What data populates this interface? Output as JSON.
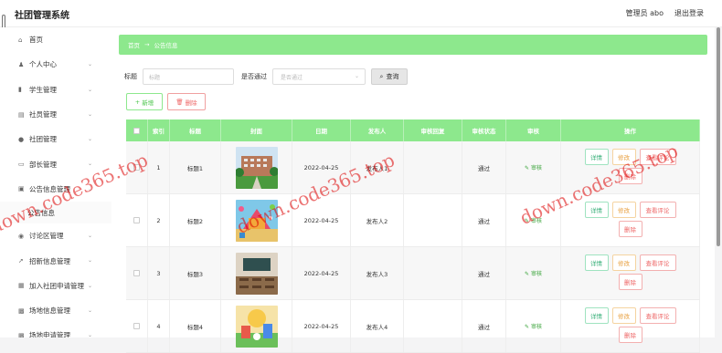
{
  "app": {
    "title": "社团管理系统",
    "admin": "管理员 abo",
    "logout": "退出登录"
  },
  "sidebar": {
    "items": [
      {
        "label": "首页",
        "icon": "home-icon",
        "glyph": "⌂",
        "chevron": false
      },
      {
        "label": "个人中心",
        "icon": "user-icon",
        "glyph": "♟",
        "chevron": true
      },
      {
        "label": "学生管理",
        "icon": "chart-icon",
        "glyph": "▮",
        "chevron": true
      },
      {
        "label": "社员管理",
        "icon": "members-icon",
        "glyph": "▤",
        "chevron": true
      },
      {
        "label": "社团管理",
        "icon": "pin-icon",
        "glyph": "●",
        "chevron": true
      },
      {
        "label": "部长管理",
        "icon": "folder-icon",
        "glyph": "▭",
        "chevron": true
      },
      {
        "label": "公告信息管理",
        "icon": "notice-icon",
        "glyph": "▣",
        "chevron": true
      },
      {
        "label": "公告信息",
        "sub": true
      },
      {
        "label": "讨论区管理",
        "icon": "discuss-icon",
        "glyph": "◉",
        "chevron": true
      },
      {
        "label": "招新信息管理",
        "icon": "send-icon",
        "glyph": "➚",
        "chevron": true
      },
      {
        "label": "加入社团申请管理",
        "icon": "apply-icon",
        "glyph": "▦",
        "chevron": true
      },
      {
        "label": "场地信息管理",
        "icon": "venue-icon",
        "glyph": "▩",
        "chevron": true
      },
      {
        "label": "场地申请管理",
        "icon": "venue-apply-icon",
        "glyph": "▩",
        "chevron": true
      }
    ]
  },
  "breadcrumb": {
    "home": "首页",
    "arrow": "→",
    "current": "公告信息"
  },
  "search": {
    "title_label": "标题",
    "title_placeholder": "标题",
    "passed_label": "是否通过",
    "passed_placeholder": "是否通过",
    "query_button": "查询"
  },
  "actions": {
    "add": "新增",
    "delete": "删除"
  },
  "table": {
    "headers": [
      "索引",
      "标题",
      "封面",
      "日期",
      "发布人",
      "审核回复",
      "审核状态",
      "审核",
      "操作"
    ],
    "rows": [
      {
        "index": "1",
        "title": "标题1",
        "date": "2022-04-25",
        "publisher": "发布人1",
        "reply": "",
        "status": "通过",
        "review": "审核",
        "cover": "building"
      },
      {
        "index": "2",
        "title": "标题2",
        "date": "2022-04-25",
        "publisher": "发布人2",
        "reply": "",
        "status": "通过",
        "review": "审核",
        "cover": "carnival"
      },
      {
        "index": "3",
        "title": "标题3",
        "date": "2022-04-25",
        "publisher": "发布人3",
        "reply": "",
        "status": "通过",
        "review": "审核",
        "cover": "classroom"
      },
      {
        "index": "4",
        "title": "标题4",
        "date": "2022-04-25",
        "publisher": "发布人4",
        "reply": "",
        "status": "通过",
        "review": "审核",
        "cover": "festival"
      }
    ],
    "ops": {
      "detail": "详情",
      "edit": "修改",
      "comments": "查看评论",
      "delete": "删除"
    }
  },
  "watermark": "down.code365.top",
  "colors": {
    "accent": "#8de88d",
    "danger": "#ee6666",
    "warn": "#e8a040"
  }
}
